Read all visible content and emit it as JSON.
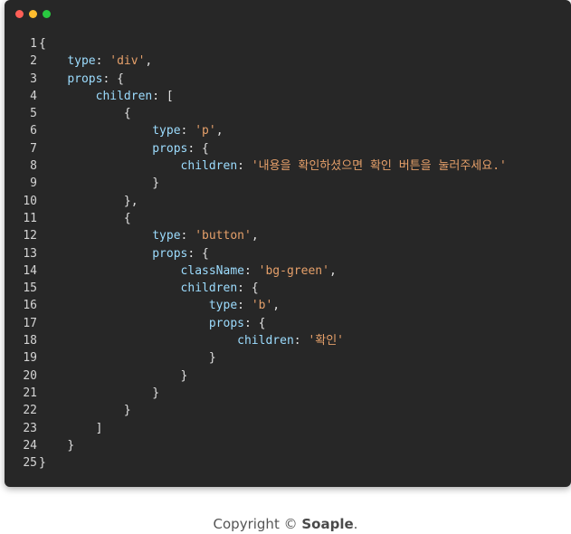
{
  "window": {
    "controls": [
      "close",
      "minimize",
      "maximize"
    ]
  },
  "code": {
    "lines": [
      {
        "n": "1",
        "tokens": [
          {
            "t": "{",
            "c": "p"
          }
        ]
      },
      {
        "n": "2",
        "indent": 1,
        "tokens": [
          {
            "t": "type",
            "c": "k"
          },
          {
            "t": ": ",
            "c": "p"
          },
          {
            "t": "'div'",
            "c": "s"
          },
          {
            "t": ",",
            "c": "p"
          }
        ]
      },
      {
        "n": "3",
        "indent": 1,
        "tokens": [
          {
            "t": "props",
            "c": "k"
          },
          {
            "t": ": {",
            "c": "p"
          }
        ]
      },
      {
        "n": "4",
        "indent": 2,
        "tokens": [
          {
            "t": "children",
            "c": "k"
          },
          {
            "t": ": [",
            "c": "p"
          }
        ]
      },
      {
        "n": "5",
        "indent": 3,
        "tokens": [
          {
            "t": "{",
            "c": "p"
          }
        ]
      },
      {
        "n": "6",
        "indent": 4,
        "tokens": [
          {
            "t": "type",
            "c": "k"
          },
          {
            "t": ": ",
            "c": "p"
          },
          {
            "t": "'p'",
            "c": "s"
          },
          {
            "t": ",",
            "c": "p"
          }
        ]
      },
      {
        "n": "7",
        "indent": 4,
        "tokens": [
          {
            "t": "props",
            "c": "k"
          },
          {
            "t": ": {",
            "c": "p"
          }
        ]
      },
      {
        "n": "8",
        "indent": 5,
        "tokens": [
          {
            "t": "children",
            "c": "k"
          },
          {
            "t": ": ",
            "c": "p"
          },
          {
            "t": "'내용을 확인하셨으면 확인 버튼을 눌러주세요.'",
            "c": "s"
          }
        ]
      },
      {
        "n": "9",
        "indent": 4,
        "tokens": [
          {
            "t": "}",
            "c": "p"
          }
        ]
      },
      {
        "n": "10",
        "indent": 3,
        "tokens": [
          {
            "t": "},",
            "c": "p"
          }
        ]
      },
      {
        "n": "11",
        "indent": 3,
        "tokens": [
          {
            "t": "{",
            "c": "p"
          }
        ]
      },
      {
        "n": "12",
        "indent": 4,
        "tokens": [
          {
            "t": "type",
            "c": "k"
          },
          {
            "t": ": ",
            "c": "p"
          },
          {
            "t": "'button'",
            "c": "s"
          },
          {
            "t": ",",
            "c": "p"
          }
        ]
      },
      {
        "n": "13",
        "indent": 4,
        "tokens": [
          {
            "t": "props",
            "c": "k"
          },
          {
            "t": ": {",
            "c": "p"
          }
        ]
      },
      {
        "n": "14",
        "indent": 5,
        "tokens": [
          {
            "t": "className",
            "c": "k"
          },
          {
            "t": ": ",
            "c": "p"
          },
          {
            "t": "'bg-green'",
            "c": "s"
          },
          {
            "t": ",",
            "c": "p"
          }
        ]
      },
      {
        "n": "15",
        "indent": 5,
        "tokens": [
          {
            "t": "children",
            "c": "k"
          },
          {
            "t": ": {",
            "c": "p"
          }
        ]
      },
      {
        "n": "16",
        "indent": 6,
        "tokens": [
          {
            "t": "type",
            "c": "k"
          },
          {
            "t": ": ",
            "c": "p"
          },
          {
            "t": "'b'",
            "c": "s"
          },
          {
            "t": ",",
            "c": "p"
          }
        ]
      },
      {
        "n": "17",
        "indent": 6,
        "tokens": [
          {
            "t": "props",
            "c": "k"
          },
          {
            "t": ": {",
            "c": "p"
          }
        ]
      },
      {
        "n": "18",
        "indent": 7,
        "tokens": [
          {
            "t": "children",
            "c": "k"
          },
          {
            "t": ": ",
            "c": "p"
          },
          {
            "t": "'확인'",
            "c": "s"
          }
        ]
      },
      {
        "n": "19",
        "indent": 6,
        "tokens": [
          {
            "t": "}",
            "c": "p"
          }
        ]
      },
      {
        "n": "20",
        "indent": 5,
        "tokens": [
          {
            "t": "}",
            "c": "p"
          }
        ]
      },
      {
        "n": "21",
        "indent": 4,
        "tokens": [
          {
            "t": "}",
            "c": "p"
          }
        ]
      },
      {
        "n": "22",
        "indent": 3,
        "tokens": [
          {
            "t": "}",
            "c": "p"
          }
        ]
      },
      {
        "n": "23",
        "indent": 2,
        "tokens": [
          {
            "t": "]",
            "c": "p"
          }
        ]
      },
      {
        "n": "24",
        "indent": 1,
        "tokens": [
          {
            "t": "}",
            "c": "p"
          }
        ]
      },
      {
        "n": "25",
        "tokens": [
          {
            "t": "}",
            "c": "p"
          }
        ]
      }
    ]
  },
  "footer": {
    "prefix": "Copyright © ",
    "brand": "Soaple",
    "suffix": "."
  },
  "colors": {
    "editor_bg": "#272727",
    "keyword": "#9cdcfe",
    "string": "#e6a06a",
    "punctuation": "#e0e0e0",
    "close": "#fe5f57",
    "minimize": "#febc2e",
    "maximize": "#29c840"
  }
}
